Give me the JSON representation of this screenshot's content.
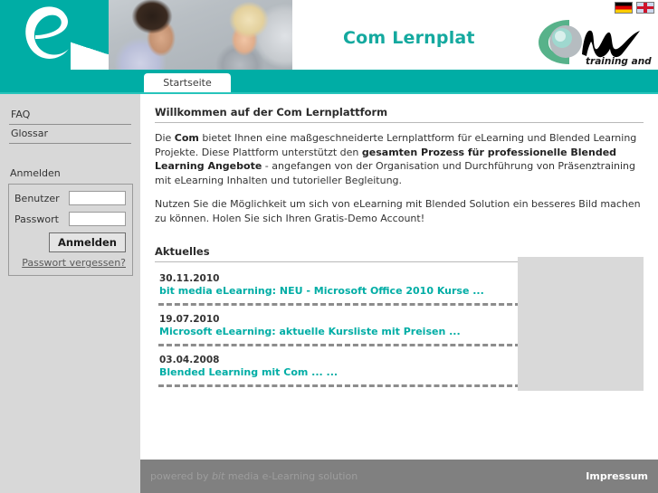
{
  "header": {
    "site_title": "Com Lernplat",
    "logo_letter": "e",
    "brand_logo_tagline": "training and services",
    "flags": [
      {
        "name": "german-flag",
        "label": "Deutsch"
      },
      {
        "name": "english-flag",
        "label": "English"
      }
    ]
  },
  "nav": {
    "active_tab": "Startseite"
  },
  "sidebar": {
    "links": [
      {
        "label": "FAQ"
      },
      {
        "label": "Glossar"
      }
    ],
    "login": {
      "heading": "Anmelden",
      "user_label": "Benutzer",
      "user_value": "",
      "user_placeholder": "",
      "password_label": "Passwort",
      "password_value": "",
      "password_placeholder": "",
      "submit_label": "Anmelden",
      "forgot_label": "Passwort vergessen?"
    }
  },
  "main": {
    "welcome_title": "Willkommen auf der Com Lernplattform",
    "paragraph1": {
      "pre": "Die ",
      "bold1": "Com",
      "mid1": " bietet Ihnen eine maßgeschneiderte Lernplattform für eLearning und Blended Learning Projekte. Diese Plattform unterstützt den ",
      "bold2": "gesamten Prozess für professionelle Blended Learning Angebote",
      "post": " - angefangen von der Organisation und Durchführung von Präsenztraining mit eLearning Inhalten und tutorieller Begleitung."
    },
    "paragraph2": "Nutzen Sie die Möglichkeit um sich von eLearning mit Blended Solution ein besseres Bild machen zu können. Holen Sie sich Ihren Gratis-Demo Account!",
    "news_title": "Aktuelles",
    "news": [
      {
        "date": "30.11.2010",
        "headline": "bit media eLearning: NEU - Microsoft Office 2010 Kurse ..."
      },
      {
        "date": "19.07.2010",
        "headline": "Microsoft eLearning: aktuelle Kursliste mit Preisen ..."
      },
      {
        "date": "03.04.2008",
        "headline": "Blended Learning mit Com ... ..."
      }
    ]
  },
  "footer": {
    "powered_pre": "powered by ",
    "powered_em": "bit",
    "powered_post": " media e-Learning solution",
    "impressum": "Impressum"
  },
  "colors": {
    "teal": "#00ada5",
    "teal_text": "#14a99f",
    "sidebar_gray": "#d8d8d8",
    "footer_gray": "#808080",
    "placeholder_gray": "#d9d9d9"
  }
}
